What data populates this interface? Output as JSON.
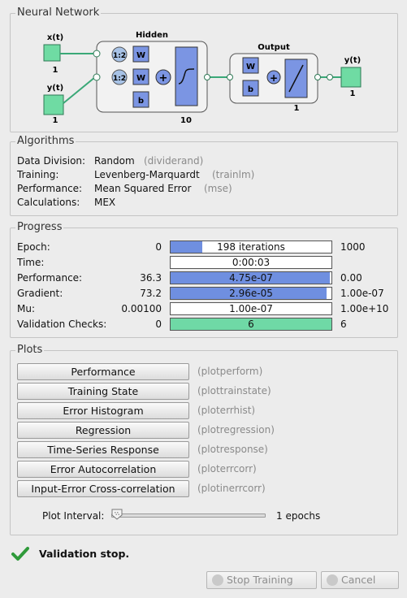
{
  "network": {
    "title": "Neural Network",
    "input1": "x(t)",
    "input1_size": "1",
    "input2": "y(t)",
    "input2_size": "1",
    "hidden_title": "Hidden",
    "delay_label1": "1:2",
    "delay_label2": "1:2",
    "weight_label": "W",
    "bias_label": "b",
    "hidden_size": "10",
    "output_title": "Output",
    "output_size": "1",
    "output_label": "y(t)",
    "output_label_size": "1"
  },
  "algorithms": {
    "title": "Algorithms",
    "rows": [
      {
        "label": "Data Division:",
        "value": "Random",
        "fn": "(dividerand)"
      },
      {
        "label": "Training:",
        "value": "Levenberg-Marquardt",
        "fn": "(trainlm)"
      },
      {
        "label": "Performance:",
        "value": "Mean Squared Error",
        "fn": "(mse)"
      },
      {
        "label": "Calculations:",
        "value": "MEX",
        "fn": ""
      }
    ]
  },
  "progress": {
    "title": "Progress",
    "rows": [
      {
        "label": "Epoch:",
        "start": "0",
        "bar_text": "198 iterations",
        "end": "1000",
        "fill": 0.198,
        "fill_color": "#6f8fe0"
      },
      {
        "label": "Time:",
        "start": "",
        "bar_text": "0:00:03",
        "end": "",
        "fill": 0,
        "fill_color": "#6f8fe0"
      },
      {
        "label": "Performance:",
        "start": "36.3",
        "bar_text": "4.75e-07",
        "end": "0.00",
        "fill": 0.99,
        "fill_color": "#6f8fe0"
      },
      {
        "label": "Gradient:",
        "start": "73.2",
        "bar_text": "2.96e-05",
        "end": "1.00e-07",
        "fill": 0.97,
        "fill_color": "#6f8fe0"
      },
      {
        "label": "Mu:",
        "start": "0.00100",
        "bar_text": "1.00e-07",
        "end": "1.00e+10",
        "fill": 0,
        "fill_color": "#6f8fe0"
      },
      {
        "label": "Validation Checks:",
        "start": "0",
        "bar_text": "6",
        "end": "6",
        "fill": 1.0,
        "fill_color": "#6fd9a6"
      }
    ]
  },
  "plots": {
    "title": "Plots",
    "buttons": [
      {
        "label": "Performance",
        "fn": "(plotperform)"
      },
      {
        "label": "Training State",
        "fn": "(plottrainstate)"
      },
      {
        "label": "Error Histogram",
        "fn": "(ploterrhist)"
      },
      {
        "label": "Regression",
        "fn": "(plotregression)"
      },
      {
        "label": "Time-Series Response",
        "fn": "(plotresponse)"
      },
      {
        "label": "Error Autocorrelation",
        "fn": "(ploterrcorr)"
      },
      {
        "label": "Input-Error Cross-correlation",
        "fn": "(plotinerrcorr)"
      }
    ],
    "interval_label": "Plot Interval:",
    "interval_value": "1 epochs",
    "interval_position": 0
  },
  "status": {
    "text": "Validation stop.",
    "icon": "checkmark-icon"
  },
  "buttons": {
    "stop": "Stop Training",
    "cancel": "Cancel"
  },
  "colors": {
    "block_blue": "#7b95e3",
    "block_green": "#6fdba3",
    "accent_green": "#2f9a3a"
  }
}
